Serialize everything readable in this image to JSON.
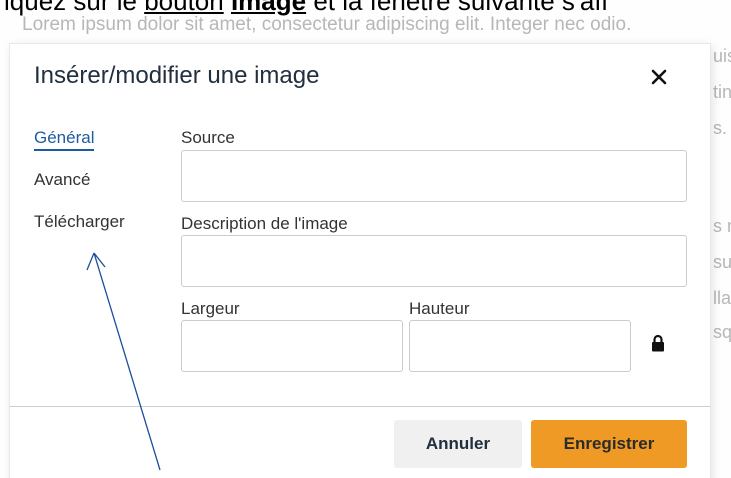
{
  "instruction": {
    "prefix": "iquez sur le ",
    "link": "bouton",
    "bold": "Image",
    "suffix": " et la fenêtre suivante s'aff"
  },
  "background": {
    "lorem": "Lorem ipsum dolor sit amet, consectetur adipiscing elit. Integer nec odio.",
    "fragments": [
      "uis",
      "tin",
      "s. (",
      "s n",
      "su",
      "lla",
      "sq"
    ]
  },
  "dialog": {
    "title": "Insérer/modifier une image",
    "close_label": "✕",
    "tabs": [
      {
        "label": "Général",
        "active": true
      },
      {
        "label": "Avancé",
        "active": false
      },
      {
        "label": "Télécharger",
        "active": false
      }
    ],
    "fields": {
      "source": {
        "label": "Source",
        "value": "",
        "placeholder": ""
      },
      "description": {
        "label": "Description de l'image",
        "value": "",
        "placeholder": ""
      },
      "width": {
        "label": "Largeur",
        "value": "",
        "placeholder": ""
      },
      "height": {
        "label": "Hauteur",
        "value": "",
        "placeholder": ""
      }
    },
    "constrain_icon": "lock-icon",
    "buttons": {
      "cancel": "Annuler",
      "save": "Enregistrer"
    }
  },
  "colors": {
    "accent_active_tab": "#1f5c9e",
    "save_button": "#ef9a24",
    "cancel_button": "#f0f0f0",
    "annotation_arrow": "#1f4e99"
  }
}
